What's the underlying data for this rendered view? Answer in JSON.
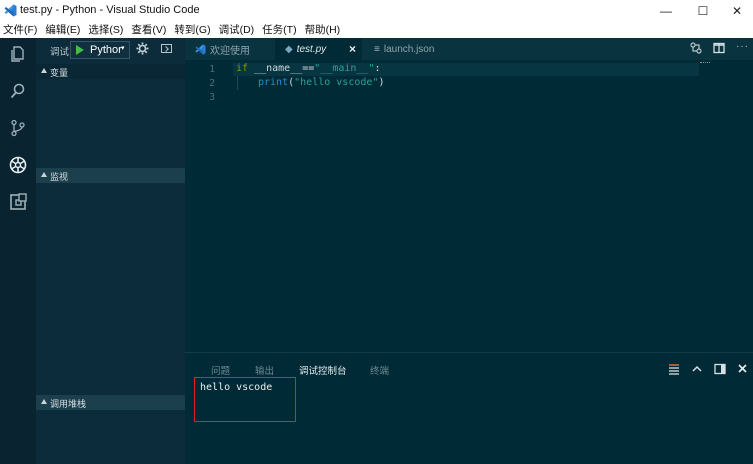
{
  "window": {
    "title": "test.py - Python - Visual Studio Code",
    "app_icon": "vscode-icon",
    "controls": {
      "minimize": "—",
      "maximize": "☐",
      "close": "✕"
    }
  },
  "menu": [
    "文件(F)",
    "编辑(E)",
    "选择(S)",
    "查看(V)",
    "转到(G)",
    "调试(D)",
    "任务(T)",
    "帮助(H)"
  ],
  "activity_bar": [
    "files-icon",
    "search-icon",
    "source-control-icon",
    "debug-icon",
    "extensions-icon"
  ],
  "debug": {
    "label": "调试",
    "configuration": "Pythor",
    "caret": "▾"
  },
  "sidebar_sections": {
    "variables": "变量",
    "watch": "监视",
    "call_stack": "调用堆栈"
  },
  "tabs": [
    {
      "label": "欢迎使用",
      "icon": "vscode-icon"
    },
    {
      "label": "test.py",
      "icon": "python-file-icon",
      "active": true,
      "close": "×"
    },
    {
      "label": "launch.json",
      "icon": "json-file-icon"
    }
  ],
  "code": {
    "line_numbers": [
      "1",
      "2",
      "3"
    ],
    "line1": {
      "kw": "if",
      "name": " __name__",
      "op": "==",
      "str": "\"__main__\"",
      "colon": ":"
    },
    "line2": {
      "fn": "print",
      "open": "(",
      "str": "\"hello vscode\"",
      "close": ")"
    }
  },
  "panel": {
    "tabs": [
      "问题",
      "输出",
      "调试控制台",
      "终端"
    ],
    "active_tab": "调试控制台",
    "output": "hello vscode"
  },
  "colors": {
    "activity_bar": "#0a2330",
    "sidebar": "#0d2c3b",
    "editor": "#002b36",
    "highlight_box": "#e0202a"
  }
}
